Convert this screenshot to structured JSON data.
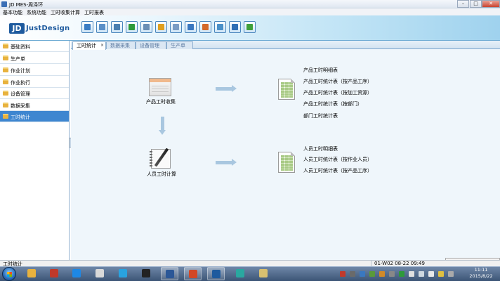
{
  "window": {
    "title": "JD MES-周泽环",
    "controls": {
      "minimize": "–",
      "maximize": "□",
      "close": "✕"
    }
  },
  "menu": [
    "基本功能",
    "系统功能",
    "工时收集计算",
    "工时报表"
  ],
  "logo": {
    "mark": "JD",
    "text": "JustDesign"
  },
  "toolbar": {
    "icons": [
      "home-icon",
      "computer-icon",
      "monitor-icon",
      "refresh-icon",
      "edit-icon",
      "printer-icon",
      "pencil-icon",
      "gear-icon",
      "users-icon",
      "chart-icon",
      "network-icon",
      "image-icon"
    ],
    "colors": [
      "#3b7dc4",
      "#5a8fc8",
      "#4b7fb0",
      "#2e9a3a",
      "#6c8fb5",
      "#e0a020",
      "#7a9cc4",
      "#3a78c0",
      "#d46a2a",
      "#4a90c8",
      "#2f6fb5",
      "#3fa03a"
    ]
  },
  "sidebar": {
    "items": [
      {
        "label": "基础资料",
        "active": false
      },
      {
        "label": "生产单",
        "active": false
      },
      {
        "label": "作业计划",
        "active": false
      },
      {
        "label": "作业执行",
        "active": false
      },
      {
        "label": "设备管理",
        "active": false
      },
      {
        "label": "数据采集",
        "active": false
      },
      {
        "label": "工时统计",
        "active": true
      }
    ]
  },
  "tabs": [
    {
      "label": "工时统计",
      "active": true,
      "close": "×"
    },
    {
      "label": "数据采集",
      "active": false
    },
    {
      "label": "设备管理",
      "active": false
    },
    {
      "label": "生产单",
      "active": false
    }
  ],
  "flow": {
    "product_collect": "产品工时收集",
    "person_calc": "人员工时计算",
    "product_reports": [
      "产品工时明细表",
      "产品工时统计表（按产品工序）",
      "产品工时统计表（按加工资源）",
      "产品工时统计表（按部门）",
      "部门工时统计表"
    ],
    "person_reports": [
      "人员工时明细表",
      "人员工时统计表（按作业人员）",
      "人员工时统计表（按产品工序）"
    ]
  },
  "status": {
    "left": "工时统计",
    "right": "01-W02 08-22 09:49"
  },
  "taskbar": {
    "apps": [
      {
        "icon": "folder-icon",
        "color": "#e8b23e",
        "open": false
      },
      {
        "icon": "sudoku-icon",
        "color": "#c0392b",
        "open": false
      },
      {
        "icon": "ie-icon",
        "color": "#1e88e5",
        "open": false
      },
      {
        "icon": "paint-icon",
        "color": "#d9d9d9",
        "open": false
      },
      {
        "icon": "browser-icon",
        "color": "#29a3e0",
        "open": false
      },
      {
        "icon": "qq-icon",
        "color": "#222222",
        "open": false
      },
      {
        "icon": "word-icon",
        "color": "#2b5797",
        "open": true
      },
      {
        "icon": "powerpoint-icon",
        "color": "#d24726",
        "open": true
      },
      {
        "icon": "jd-mes-icon",
        "color": "#1e5a9e",
        "open": true
      },
      {
        "icon": "map-icon",
        "color": "#2aa8a0",
        "open": false
      },
      {
        "icon": "palette-icon",
        "color": "#d8c070",
        "open": false
      }
    ],
    "tray_icons": [
      "lang-icon",
      "tray-app-icon",
      "tray-app-icon",
      "tray-app-icon",
      "tray-app-icon",
      "tray-app-icon",
      "shield-icon",
      "flag-icon",
      "network-icon",
      "volume-icon",
      "power-icon",
      "tray-app-icon"
    ],
    "clock_time": "11:11",
    "clock_date": "2015/8/22"
  }
}
